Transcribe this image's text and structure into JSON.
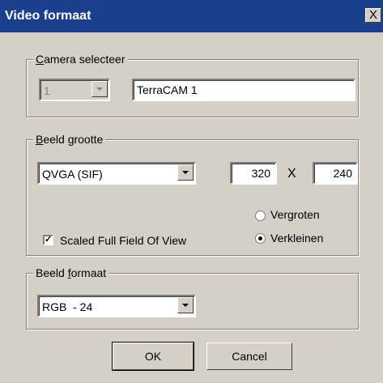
{
  "window": {
    "title": "Video formaat",
    "close_label": "X"
  },
  "camera": {
    "legend_pre": "",
    "legend_u": "C",
    "legend_post": "amera selecteer",
    "number_value": "1",
    "name_value": "TerraCAM 1"
  },
  "image_size": {
    "legend_u": "B",
    "legend_post": "eeld grootte",
    "preset_value": "QVGA (SIF)",
    "width_value": "320",
    "times_label": "X",
    "height_value": "240",
    "scaled_label": "Scaled Full Field Of View",
    "scaled_checked": true,
    "enlarge_label": "Vergroten",
    "shrink_label": "Verkleinen",
    "selected_radio": "Verkleinen"
  },
  "image_format": {
    "legend_pre": "Beeld ",
    "legend_u": "f",
    "legend_post": "ormaat",
    "format_value": "RGB  - 24"
  },
  "buttons": {
    "ok_label": "OK",
    "cancel_label": "Cancel"
  }
}
